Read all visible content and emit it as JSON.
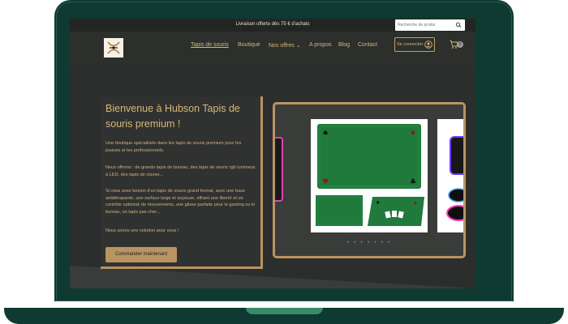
{
  "topbar": {
    "promo": "Livraison offerte dès 75 € d'achats",
    "search_placeholder": "Recherche de produi"
  },
  "header": {
    "nav": [
      {
        "label": "Tapis de souris",
        "active": true
      },
      {
        "label": "Boutique"
      },
      {
        "label": "Nos offres ⌄"
      },
      {
        "label": "A propos"
      },
      {
        "label": "Blog"
      },
      {
        "label": "Contact"
      }
    ],
    "login_label": "Se connecter",
    "cart_count": "0"
  },
  "hero": {
    "title": "Bienvenue à Hubson Tapis de souris premium !",
    "paragraphs": [
      "Une boutique spécialisée dans les tapis de souris premium pour les joueurs et les professionnels.",
      "Nous offrons : de grands tapis de bureau, des tapis de souris rgb lumineux à LED, des tapis de clavier...",
      "Si vous avez besoin d'un tapis de souris grand format, avec une base antidérapante, une surface large et soyeuse, offrant une liberté et un contrôle optimisé de mouvements, une glisse parfaite pour le gaming ou le bureau, un tapis pas cher...",
      "Nous avons une solution pour vous !"
    ],
    "cta_label": "Commander maintenant"
  },
  "carousel": {
    "dots": "● ● ● ● ● ● ●"
  },
  "colors": {
    "accent": "#b99460",
    "frame": "#0e3a31",
    "felt": "#1f7a3c"
  }
}
